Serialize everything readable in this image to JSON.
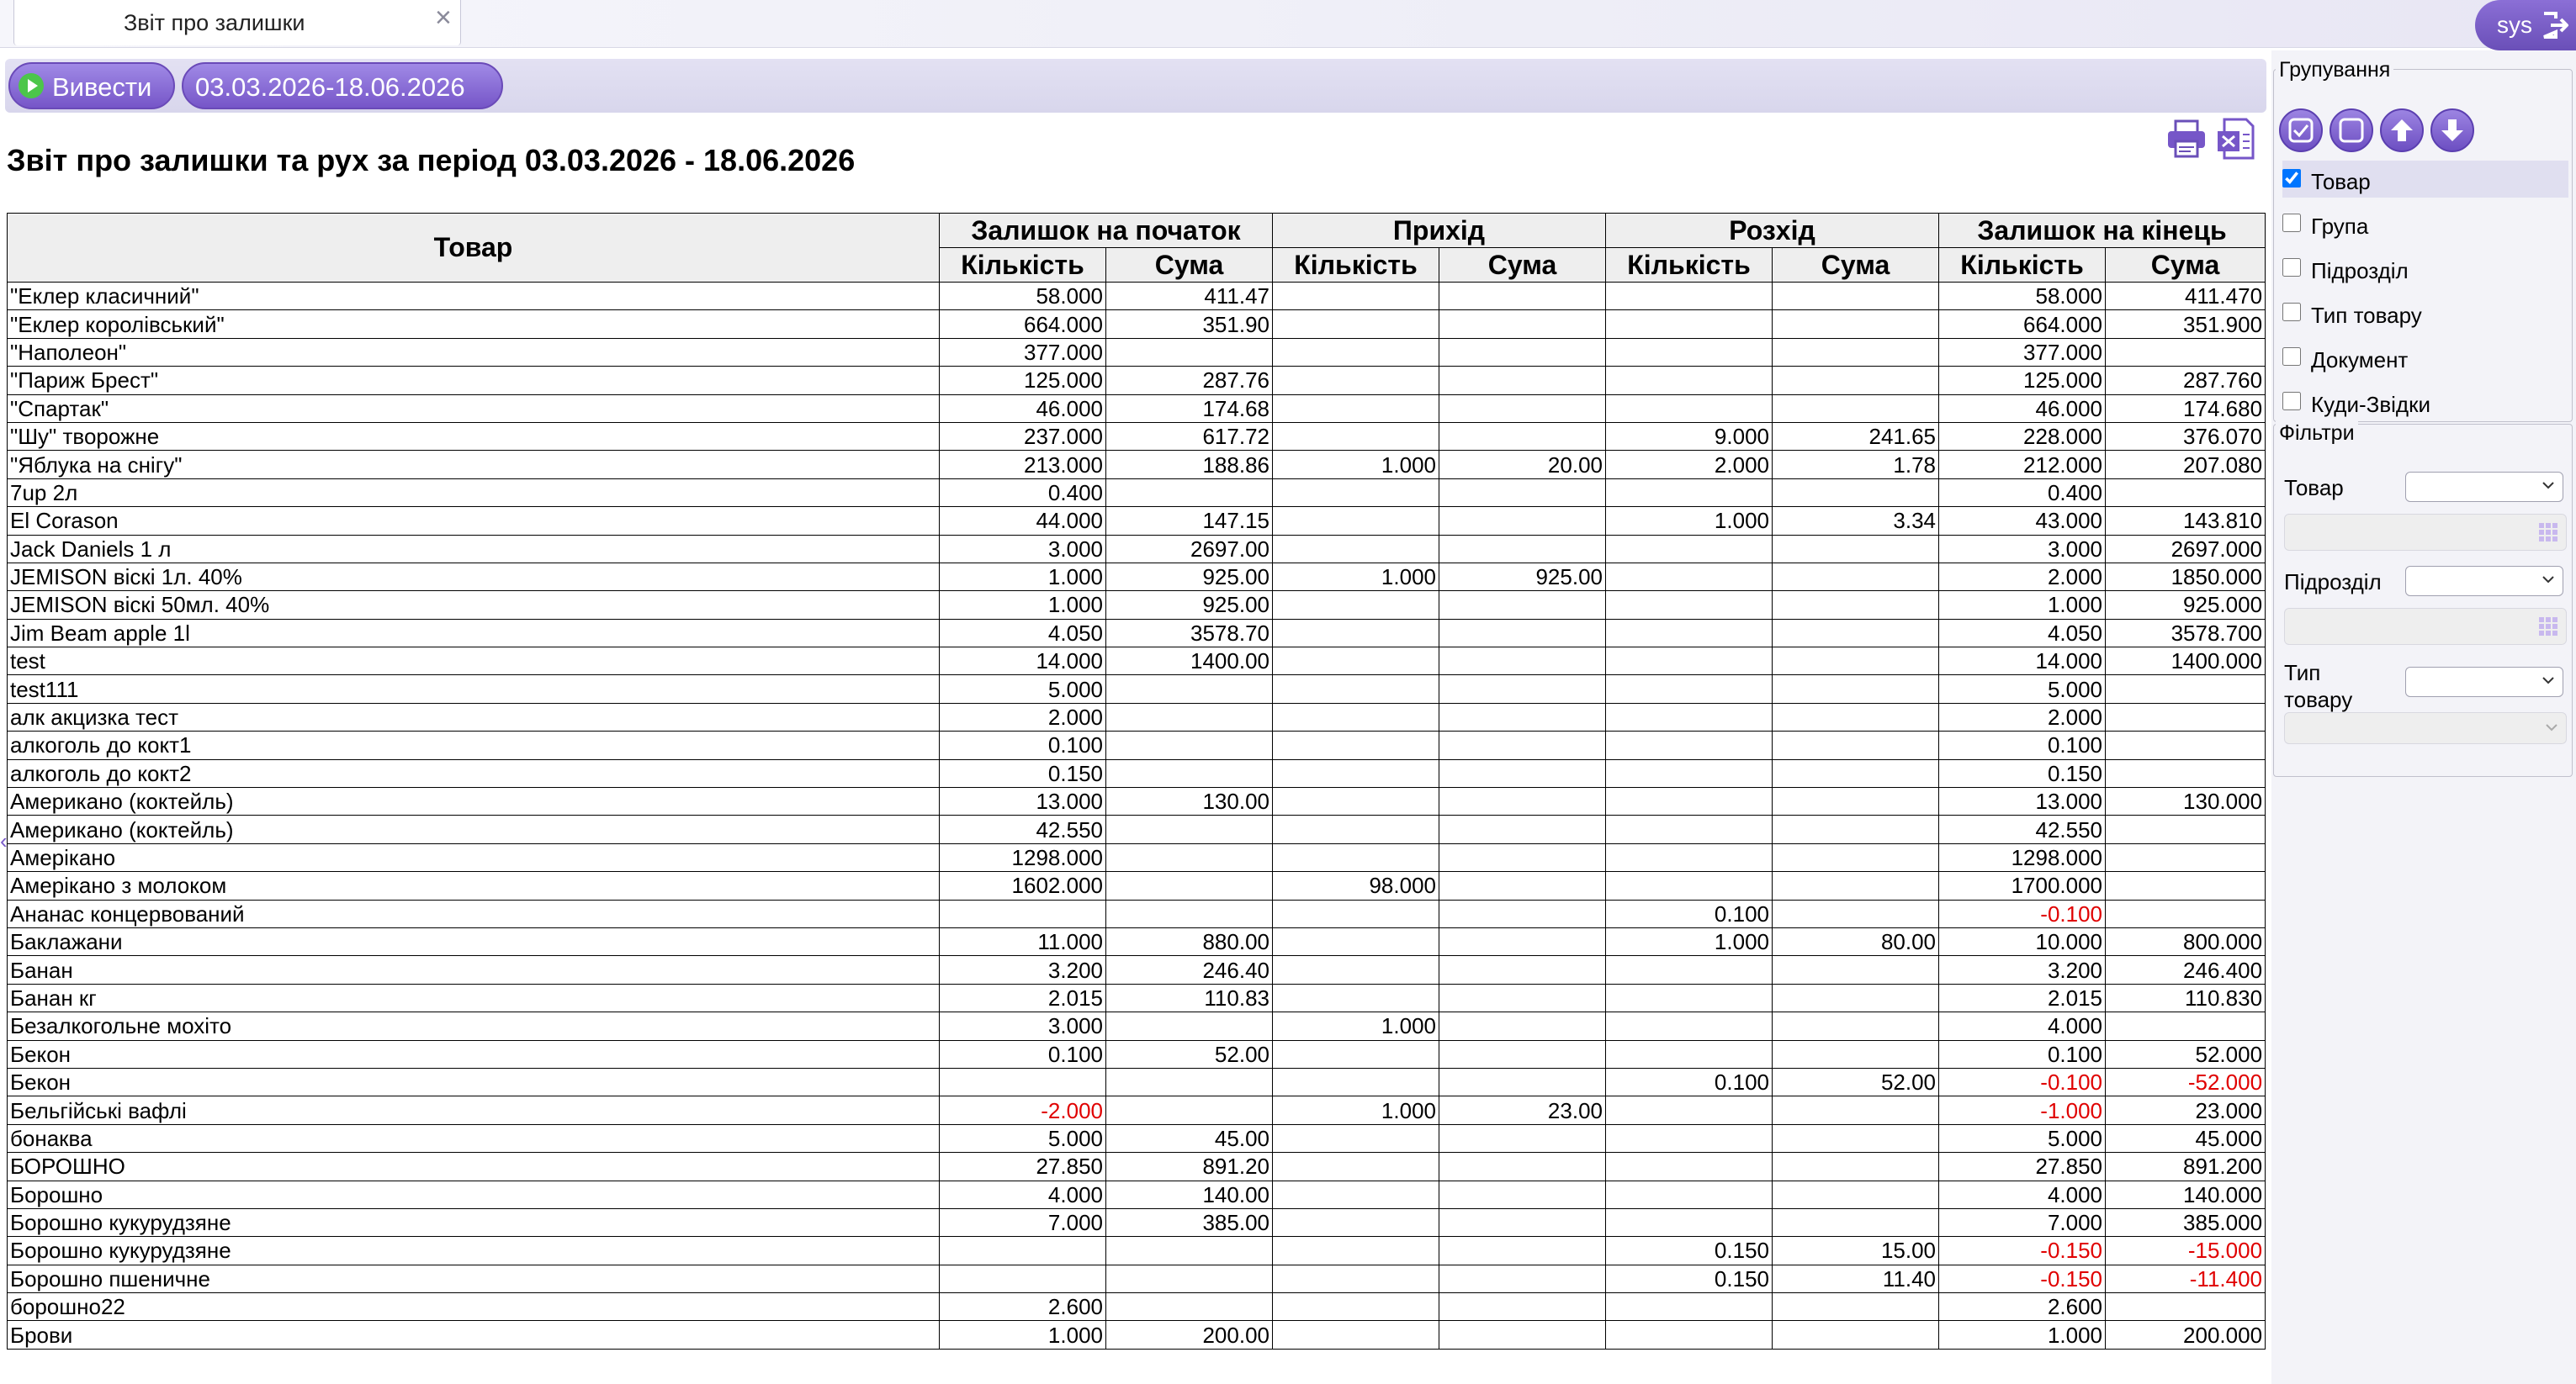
{
  "tab": {
    "label": "Звіт про залишки"
  },
  "user": {
    "name": "sys"
  },
  "toolbar": {
    "run_label": "Вивести",
    "period_label": "03.03.2026-18.06.2026"
  },
  "report": {
    "title": "Звіт про залишки та рух за період 03.03.2026 - 18.06.2026",
    "headers": {
      "product": "Товар",
      "groups": [
        "Залишок на початок",
        "Прихід",
        "Розхід",
        "Залишок на кінець"
      ],
      "sub": [
        "Кількість",
        "Сума",
        "Кількість",
        "Сума",
        "Кількість",
        "Сума",
        "Кількість",
        "Сума"
      ]
    },
    "rows": [
      [
        "\"Еклер класичний\"",
        "58.000",
        "411.47",
        "",
        "",
        "",
        "",
        "58.000",
        "411.470"
      ],
      [
        "\"Еклер королівський\"",
        "664.000",
        "351.90",
        "",
        "",
        "",
        "",
        "664.000",
        "351.900"
      ],
      [
        "\"Наполеон\"",
        "377.000",
        "",
        "",
        "",
        "",
        "",
        "377.000",
        ""
      ],
      [
        "\"Париж Брест\"",
        "125.000",
        "287.76",
        "",
        "",
        "",
        "",
        "125.000",
        "287.760"
      ],
      [
        "\"Спартак\"",
        "46.000",
        "174.68",
        "",
        "",
        "",
        "",
        "46.000",
        "174.680"
      ],
      [
        "\"Шу\" творожне",
        "237.000",
        "617.72",
        "",
        "",
        "9.000",
        "241.65",
        "228.000",
        "376.070"
      ],
      [
        "\"Яблука на снігу\"",
        "213.000",
        "188.86",
        "1.000",
        "20.00",
        "2.000",
        "1.78",
        "212.000",
        "207.080"
      ],
      [
        "7up 2л",
        "0.400",
        "",
        "",
        "",
        "",
        "",
        "0.400",
        ""
      ],
      [
        "El Corason",
        "44.000",
        "147.15",
        "",
        "",
        "1.000",
        "3.34",
        "43.000",
        "143.810"
      ],
      [
        "Jack Daniels 1 л",
        "3.000",
        "2697.00",
        "",
        "",
        "",
        "",
        "3.000",
        "2697.000"
      ],
      [
        "JEMISON віскі 1л. 40%",
        "1.000",
        "925.00",
        "1.000",
        "925.00",
        "",
        "",
        "2.000",
        "1850.000"
      ],
      [
        "JEMISON віскі 50мл. 40%",
        "1.000",
        "925.00",
        "",
        "",
        "",
        "",
        "1.000",
        "925.000"
      ],
      [
        "Jim Beam apple 1l",
        "4.050",
        "3578.70",
        "",
        "",
        "",
        "",
        "4.050",
        "3578.700"
      ],
      [
        "test",
        "14.000",
        "1400.00",
        "",
        "",
        "",
        "",
        "14.000",
        "1400.000"
      ],
      [
        "test111",
        "5.000",
        "",
        "",
        "",
        "",
        "",
        "5.000",
        ""
      ],
      [
        "алк акцизка тест",
        "2.000",
        "",
        "",
        "",
        "",
        "",
        "2.000",
        ""
      ],
      [
        "алкоголь до кокт1",
        "0.100",
        "",
        "",
        "",
        "",
        "",
        "0.100",
        ""
      ],
      [
        "алкоголь до кокт2",
        "0.150",
        "",
        "",
        "",
        "",
        "",
        "0.150",
        ""
      ],
      [
        "Американо (коктейль)",
        "13.000",
        "130.00",
        "",
        "",
        "",
        "",
        "13.000",
        "130.000"
      ],
      [
        "Американо (коктейль)",
        "42.550",
        "",
        "",
        "",
        "",
        "",
        "42.550",
        ""
      ],
      [
        "Амерікано",
        "1298.000",
        "",
        "",
        "",
        "",
        "",
        "1298.000",
        ""
      ],
      [
        "Амерікано з молоком",
        "1602.000",
        "",
        "98.000",
        "",
        "",
        "",
        "1700.000",
        ""
      ],
      [
        "Ананас концервований",
        "",
        "",
        "",
        "",
        "0.100",
        "",
        "-0.100",
        ""
      ],
      [
        "Баклажани",
        "11.000",
        "880.00",
        "",
        "",
        "1.000",
        "80.00",
        "10.000",
        "800.000"
      ],
      [
        "Банан",
        "3.200",
        "246.40",
        "",
        "",
        "",
        "",
        "3.200",
        "246.400"
      ],
      [
        "Банан кг",
        "2.015",
        "110.83",
        "",
        "",
        "",
        "",
        "2.015",
        "110.830"
      ],
      [
        "Безалкогольне мохіто",
        "3.000",
        "",
        "1.000",
        "",
        "",
        "",
        "4.000",
        ""
      ],
      [
        "Бекон",
        "0.100",
        "52.00",
        "",
        "",
        "",
        "",
        "0.100",
        "52.000"
      ],
      [
        "Бекон",
        "",
        "",
        "",
        "",
        "0.100",
        "52.00",
        "-0.100",
        "-52.000"
      ],
      [
        "Бельгійські вафлі",
        "-2.000",
        "",
        "1.000",
        "23.00",
        "",
        "",
        "-1.000",
        "23.000"
      ],
      [
        "бонаква",
        "5.000",
        "45.00",
        "",
        "",
        "",
        "",
        "5.000",
        "45.000"
      ],
      [
        "БОРОШНО",
        "27.850",
        "891.20",
        "",
        "",
        "",
        "",
        "27.850",
        "891.200"
      ],
      [
        "Борошно",
        "4.000",
        "140.00",
        "",
        "",
        "",
        "",
        "4.000",
        "140.000"
      ],
      [
        "Борошно кукурудзяне",
        "7.000",
        "385.00",
        "",
        "",
        "",
        "",
        "7.000",
        "385.000"
      ],
      [
        "Борошно кукурудзяне",
        "",
        "",
        "",
        "",
        "0.150",
        "15.00",
        "-0.150",
        "-15.000"
      ],
      [
        "Борошно пшеничне",
        "",
        "",
        "",
        "",
        "0.150",
        "11.40",
        "-0.150",
        "-11.400"
      ],
      [
        "борошно22",
        "2.600",
        "",
        "",
        "",
        "",
        "",
        "2.600",
        ""
      ],
      [
        "Брови",
        "1.000",
        "200.00",
        "",
        "",
        "",
        "",
        "1.000",
        "200.000"
      ]
    ]
  },
  "grouping": {
    "legend": "Групування",
    "buttons": [
      "check-all-icon",
      "uncheck-all-icon",
      "arrow-up-icon",
      "arrow-down-icon"
    ],
    "options": [
      {
        "label": "Товар",
        "checked": true
      },
      {
        "label": "Група",
        "checked": false
      },
      {
        "label": "Підрозділ",
        "checked": false
      },
      {
        "label": "Тип товару",
        "checked": false
      },
      {
        "label": "Документ",
        "checked": false
      },
      {
        "label": "Куди-Звідки",
        "checked": false
      }
    ]
  },
  "filters": {
    "legend": "Фільтри",
    "product_label": "Товар",
    "division_label": "Підрозділ",
    "type_label_1": "Тип",
    "type_label_2": "товару"
  },
  "colors": {
    "accent": "#7656c8",
    "negative": "#e00000",
    "header_bg": "#eeeeee"
  }
}
